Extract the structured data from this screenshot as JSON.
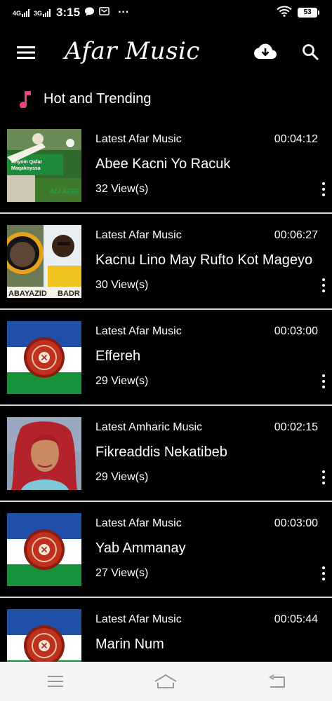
{
  "status_bar": {
    "network_1": "4G",
    "network_2": "3G",
    "time": "3:15",
    "notification_icons": [
      "chat-bubble-icon",
      "mail-icon"
    ],
    "overflow_indicator": "···",
    "battery_level": "53"
  },
  "app_bar": {
    "title": "Afar Music",
    "icons": [
      "hamburger-menu-icon",
      "cloud-download-icon",
      "search-icon"
    ]
  },
  "section": {
    "label": "Hot and Trending",
    "icon": "music-note-icon",
    "icon_color": "#e8457a"
  },
  "songs": [
    {
      "category": "Latest Afar Music",
      "duration": "00:04:12",
      "title": "Abee Kacni Yo Racuk",
      "views": "32 View(s)",
      "thumb": "photo",
      "thumb_text_1": "Anyom Qafar",
      "thumb_text_2": "Maqakoyssa",
      "thumb_text_3": "ALI AFRI"
    },
    {
      "category": "Latest Afar Music",
      "duration": "00:06:27",
      "title": "Kacnu Lino May Rufto Kot Mageyo",
      "views": "30 View(s)",
      "thumb": "photo",
      "thumb_text_1": "ABAYAZID",
      "thumb_text_2": "BADR"
    },
    {
      "category": "Latest Afar Music",
      "duration": "00:03:00",
      "title": "Effereh",
      "views": "29 View(s)",
      "thumb": "flag"
    },
    {
      "category": "Latest Amharic Music",
      "duration": "00:02:15",
      "title": "Fikreaddis Nekatibeb",
      "views": "29 View(s)",
      "thumb": "photo"
    },
    {
      "category": "Latest Afar Music",
      "duration": "00:03:00",
      "title": "Yab Ammanay",
      "views": "27 View(s)",
      "thumb": "flag"
    },
    {
      "category": "Latest Afar Music",
      "duration": "00:05:44",
      "title": "Marin Num",
      "views": "",
      "thumb": "flag"
    }
  ],
  "colors": {
    "background": "#000000",
    "flag_blue": "#1f4fa8",
    "flag_white": "#ffffff",
    "flag_green": "#17913a",
    "emblem_red": "#c0301e"
  },
  "nav_bar": {
    "icons": [
      "recent-apps-icon",
      "home-icon",
      "back-icon"
    ]
  }
}
